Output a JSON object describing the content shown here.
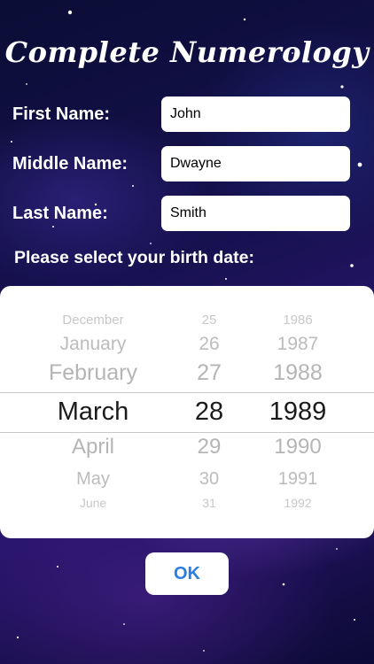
{
  "app": {
    "title": "Complete Numerology"
  },
  "form": {
    "first_name_label": "First Name:",
    "first_name_value": "John",
    "middle_name_label": "Middle Name:",
    "middle_name_value": "Dwayne",
    "last_name_label": "Last Name:",
    "last_name_value": "Smith",
    "birth_prompt": "Please select your birth date:"
  },
  "picker": {
    "months": [
      "December",
      "January",
      "February",
      "March",
      "April",
      "May",
      "June"
    ],
    "days": [
      "25",
      "26",
      "27",
      "28",
      "29",
      "30",
      "31"
    ],
    "years": [
      "1986",
      "1987",
      "1988",
      "1989",
      "1990",
      "1991",
      "1992"
    ],
    "selected_index": 3
  },
  "ok_button": {
    "label": "OK",
    "color": "#2a7ee0"
  }
}
